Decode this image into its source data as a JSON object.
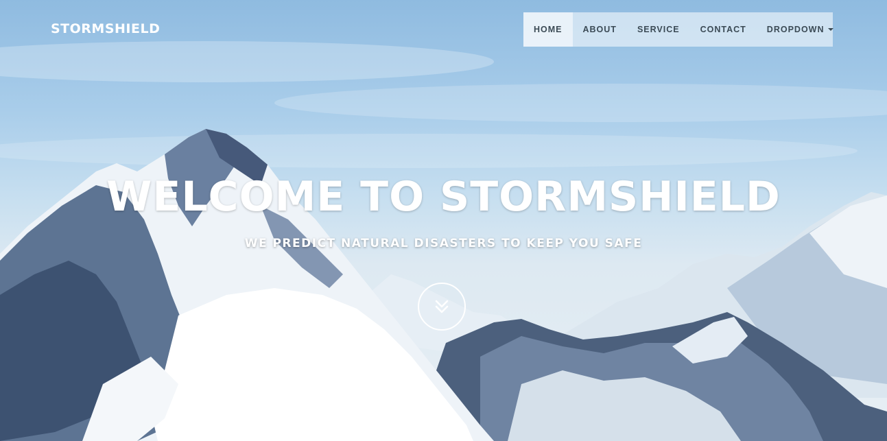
{
  "brand": {
    "name": "STORMSHIELD"
  },
  "nav": {
    "items": [
      {
        "label": "HOME",
        "active": true
      },
      {
        "label": "ABOUT",
        "active": false
      },
      {
        "label": "SERVICE",
        "active": false
      },
      {
        "label": "CONTACT",
        "active": false
      },
      {
        "label": "DROPDOWN",
        "active": false,
        "icon": "caret-down-icon"
      }
    ]
  },
  "hero": {
    "title": "WELCOME TO STORMSHIELD",
    "subtitle": "WE PREDICT NATURAL DISASTERS TO KEEP YOU SAFE",
    "scroll_icon": "double-chevron-down-icon",
    "background": "snowy-mountains-photo"
  },
  "colors": {
    "nav_text": "#3b4a55",
    "headline": "#ffffff",
    "sky": "#a9cdea"
  }
}
